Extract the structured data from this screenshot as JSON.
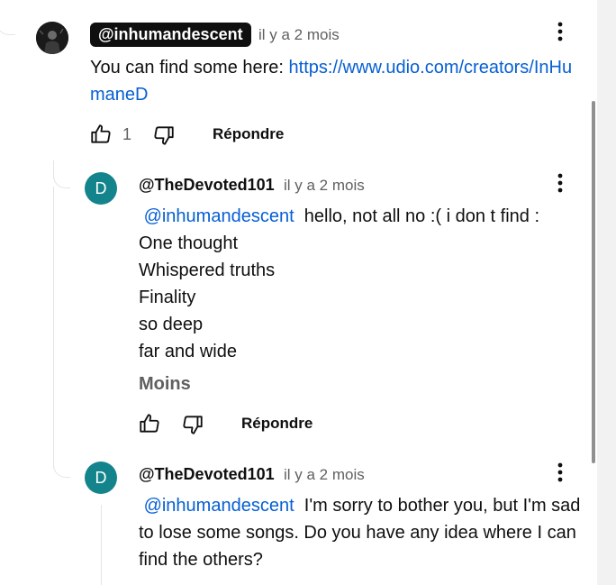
{
  "comments": [
    {
      "author": "@inhumandescent",
      "time": "il y a 2 mois",
      "text": "You can find some here: ",
      "link": "https://www.udio.com/creators/InHumaneD",
      "like_count": "1",
      "reply_label": "Répondre",
      "avatar_icon": "user-avatar-image"
    },
    {
      "author": "@TheDevoted101",
      "time": "il y a 2 mois",
      "avatar_letter": "D",
      "mention": "@inhumandescent",
      "first_line": " hello, not all no :( i don t find :",
      "lines": [
        "One thought",
        "Whispered truths",
        "Finality",
        "so deep",
        "far and wide"
      ],
      "less_label": "Moins",
      "reply_label": "Répondre"
    },
    {
      "author": "@TheDevoted101",
      "time": "il y a 2 mois",
      "avatar_letter": "D",
      "mention": "@inhumandescent",
      "text": " I'm sorry to bother you, but I'm sad to lose some songs. Do you have any idea where I can find the others?"
    }
  ],
  "icons": {
    "like": "thumb-up-icon",
    "dislike": "thumb-down-icon",
    "more": "more-vert-icon"
  },
  "colors": {
    "link": "#065fd4",
    "avatar_bg": "#14848c",
    "secondary_text": "#606060"
  }
}
